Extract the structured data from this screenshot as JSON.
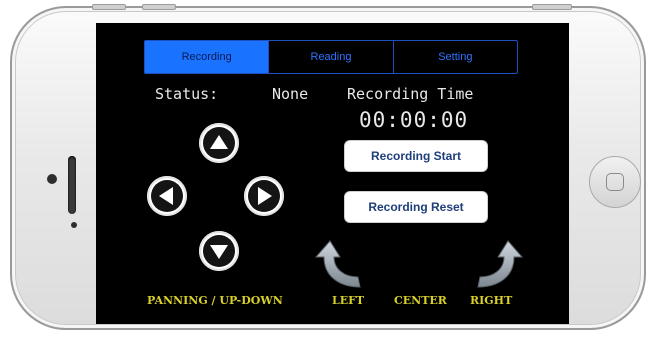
{
  "tabs": [
    {
      "label": "Recording",
      "active": true
    },
    {
      "label": "Reading",
      "active": false
    },
    {
      "label": "Setting",
      "active": false
    }
  ],
  "status": {
    "label": "Status:",
    "value": "None"
  },
  "recording_time": {
    "label": "Recording Time",
    "value": "00:00:00"
  },
  "buttons": {
    "start": "Recording Start",
    "reset": "Recording Reset"
  },
  "footer": {
    "panning": "PANNING / UP-DOWN",
    "left": "LEFT",
    "center": "CENTER",
    "right": "RIGHT"
  },
  "icons": {
    "up": "arrow-up-icon",
    "left": "arrow-left-icon",
    "right": "arrow-right-icon",
    "down": "arrow-down-icon",
    "turn_left": "curved-arrow-left-icon",
    "turn_right": "curved-arrow-right-icon"
  },
  "colors": {
    "active_tab": "#1a73ff",
    "tab_border": "#1e4fbf",
    "footer_text": "#d8cf2a",
    "button_text": "#1f3f7a"
  }
}
